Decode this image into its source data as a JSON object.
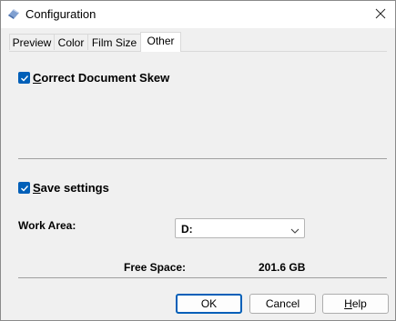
{
  "window": {
    "title": "Configuration"
  },
  "tabs": [
    {
      "label": "Preview",
      "active": false
    },
    {
      "label": "Color",
      "active": false
    },
    {
      "label": "Film Size",
      "active": false
    },
    {
      "label": "Other",
      "active": true
    }
  ],
  "options": {
    "correct_skew": {
      "label_mnemonic": "C",
      "label_rest": "orrect Document Skew",
      "checked": true
    },
    "save_settings": {
      "label_mnemonic": "S",
      "label_rest": "ave settings",
      "checked": true
    }
  },
  "work_area": {
    "label": "Work Area:",
    "value": "D:"
  },
  "free_space": {
    "label": "Free Space:",
    "value": "201.6 GB"
  },
  "buttons": {
    "ok": "OK",
    "cancel": "Cancel",
    "help": "Help"
  },
  "colors": {
    "accent": "#005fb8"
  }
}
